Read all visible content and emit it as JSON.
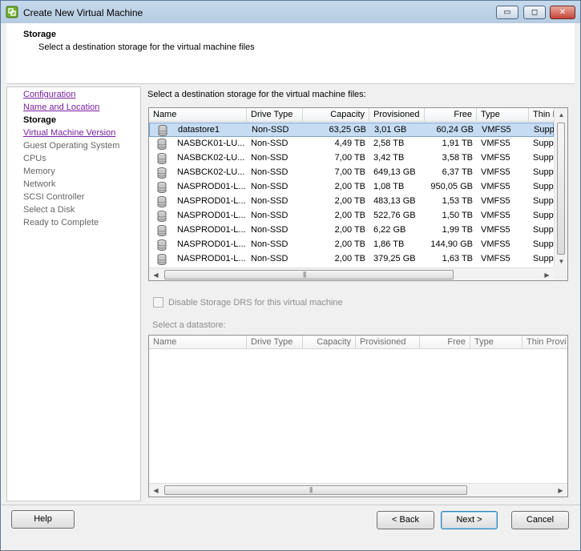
{
  "window": {
    "title": "Create New Virtual Machine",
    "controls": {
      "minimize": "▭",
      "maximize": "◻",
      "close": "✕"
    }
  },
  "header": {
    "title": "Storage",
    "subtitle": "Select a destination storage for the virtual machine files"
  },
  "nav": {
    "items": [
      {
        "label": "Configuration",
        "state": "link"
      },
      {
        "label": "Name and Location",
        "state": "link"
      },
      {
        "label": "Storage",
        "state": "current"
      },
      {
        "label": "Virtual Machine Version",
        "state": "link"
      },
      {
        "label": "Guest Operating System",
        "state": "pending"
      },
      {
        "label": "CPUs",
        "state": "pending"
      },
      {
        "label": "Memory",
        "state": "pending"
      },
      {
        "label": "Network",
        "state": "pending"
      },
      {
        "label": "SCSI Controller",
        "state": "pending"
      },
      {
        "label": "Select a Disk",
        "state": "pending"
      },
      {
        "label": "Ready to Complete",
        "state": "pending"
      }
    ]
  },
  "main": {
    "label": "Select a destination storage for the virtual machine files:",
    "columns": [
      "Name",
      "Drive Type",
      "Capacity",
      "Provisioned",
      "Free",
      "Type",
      "Thin I"
    ],
    "rows": [
      [
        "datastore1",
        "Non-SSD",
        "63,25 GB",
        "3,01 GB",
        "60,24 GB",
        "VMFS5",
        "Supp"
      ],
      [
        "NASBCK01-LU...",
        "Non-SSD",
        "4,49 TB",
        "2,58 TB",
        "1,91 TB",
        "VMFS5",
        "Supp"
      ],
      [
        "NASBCK02-LU...",
        "Non-SSD",
        "7,00 TB",
        "3,42 TB",
        "3,58 TB",
        "VMFS5",
        "Supp"
      ],
      [
        "NASBCK02-LU...",
        "Non-SSD",
        "7,00 TB",
        "649,13 GB",
        "6,37 TB",
        "VMFS5",
        "Supp"
      ],
      [
        "NASPROD01-L...",
        "Non-SSD",
        "2,00 TB",
        "1,08 TB",
        "950,05 GB",
        "VMFS5",
        "Supp"
      ],
      [
        "NASPROD01-L...",
        "Non-SSD",
        "2,00 TB",
        "483,13 GB",
        "1,53 TB",
        "VMFS5",
        "Supp"
      ],
      [
        "NASPROD01-L...",
        "Non-SSD",
        "2,00 TB",
        "522,76 GB",
        "1,50 TB",
        "VMFS5",
        "Supp"
      ],
      [
        "NASPROD01-L...",
        "Non-SSD",
        "2,00 TB",
        "6,22 GB",
        "1,99 TB",
        "VMFS5",
        "Supp"
      ],
      [
        "NASPROD01-L...",
        "Non-SSD",
        "2,00 TB",
        "1,86 TB",
        "144,90 GB",
        "VMFS5",
        "Supp"
      ],
      [
        "NASPROD01-L...",
        "Non-SSD",
        "2,00 TB",
        "379,25 GB",
        "1,63 TB",
        "VMFS5",
        "Supp"
      ]
    ],
    "selected_row": 0,
    "checkbox_label": "Disable Storage DRS for this virtual machine",
    "checkbox_checked": false,
    "select_label": "Select a datastore:",
    "columns2": [
      "Name",
      "Drive Type",
      "Capacity",
      "Provisioned",
      "Free",
      "Type",
      "Thin Provi"
    ]
  },
  "footer": {
    "help": "Help",
    "back": "< Back",
    "next": "Next >",
    "cancel": "Cancel"
  }
}
